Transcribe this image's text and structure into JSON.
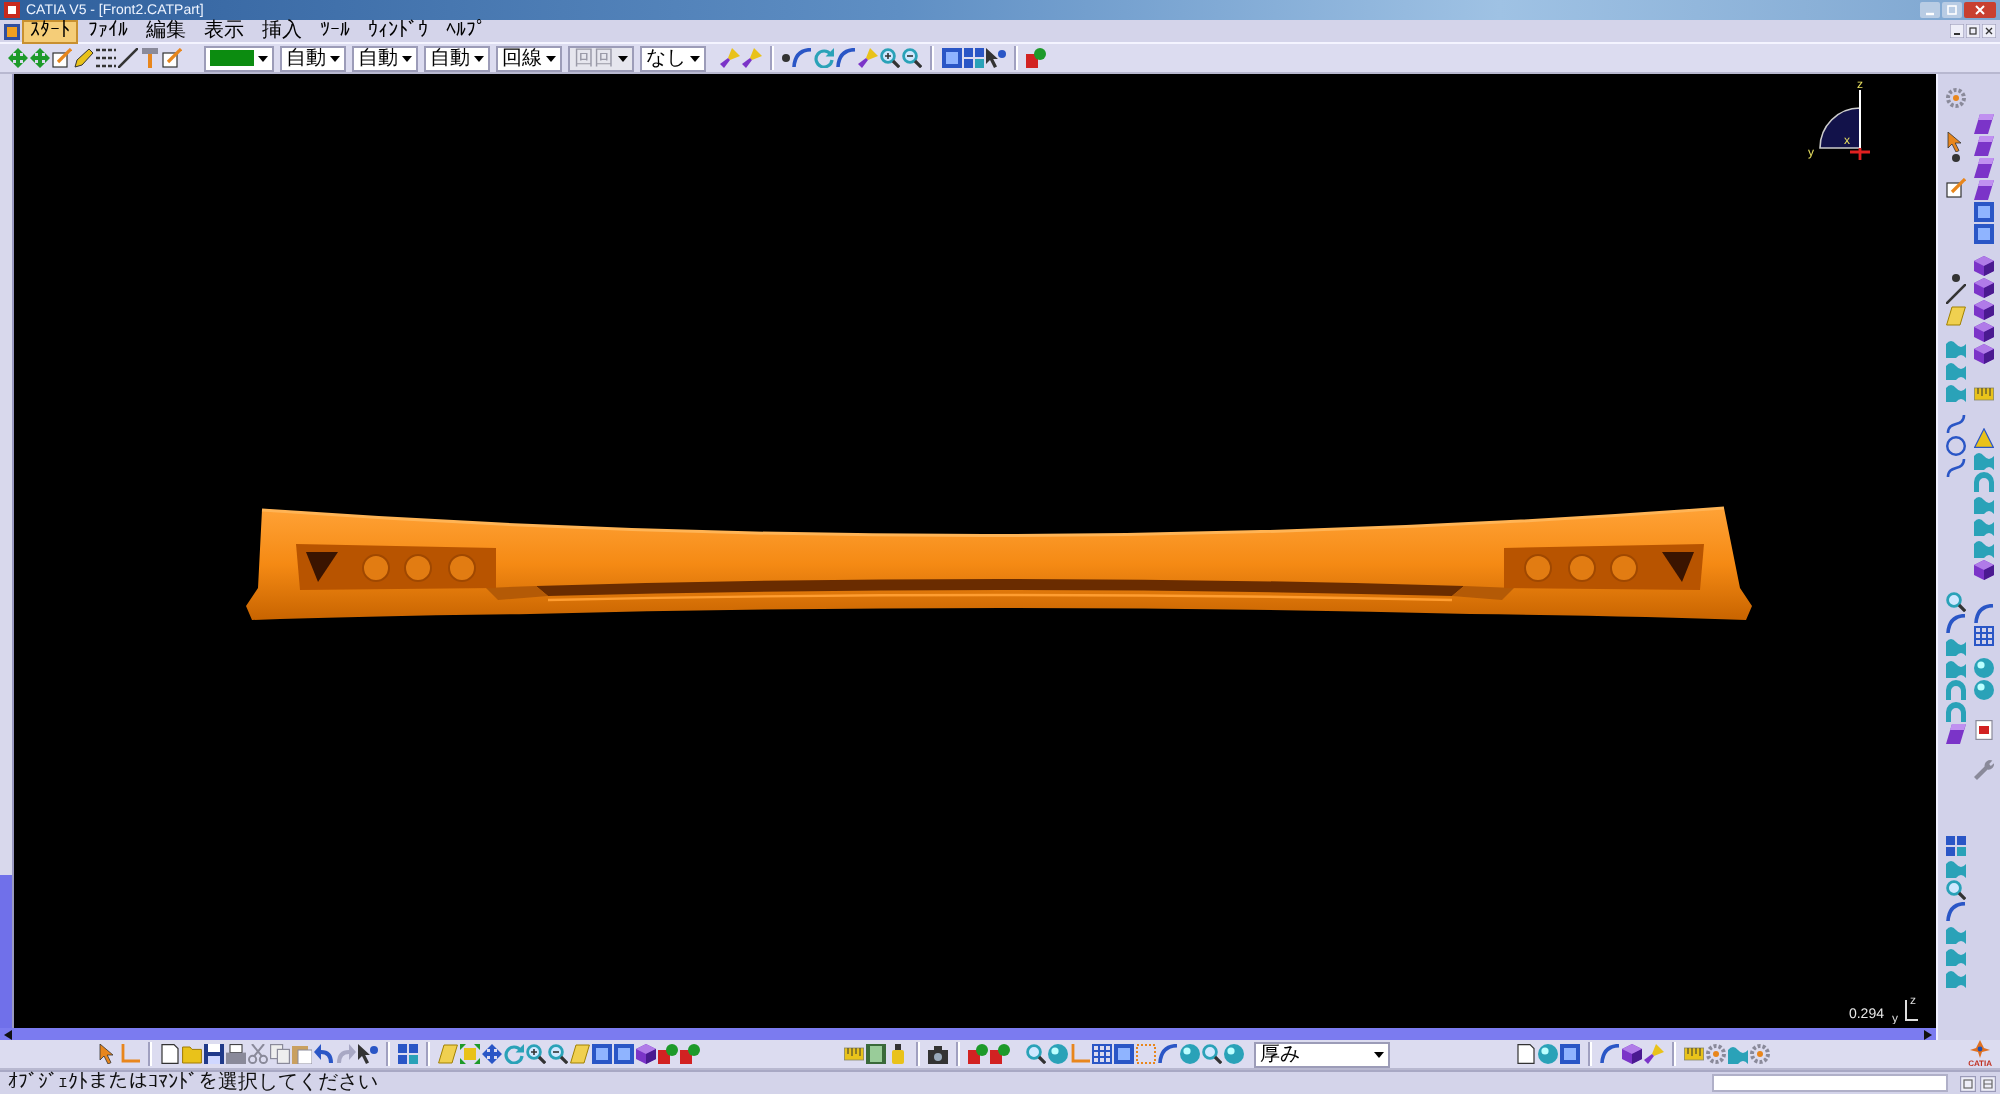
{
  "window": {
    "title": "CATIA V5 - [Front2.CATPart]"
  },
  "menu_bar": {
    "items": [
      {
        "label": "ｽﾀｰﾄ",
        "selected": true
      },
      {
        "label": "ﾌｧｲﾙ",
        "selected": false
      },
      {
        "label": "編集",
        "selected": false
      },
      {
        "label": "表示",
        "selected": false
      },
      {
        "label": "挿入",
        "selected": false
      },
      {
        "label": "ﾂｰﾙ",
        "selected": false
      },
      {
        "label": "ｳｨﾝﾄﾞｳ",
        "selected": false
      },
      {
        "label": "ﾍﾙﾌﾟ",
        "selected": false
      }
    ]
  },
  "graphic_properties": [
    {
      "kind": "color",
      "color": "#0c8c10"
    },
    {
      "kind": "text",
      "value": "自動",
      "disabled": false
    },
    {
      "kind": "text",
      "value": "自動",
      "disabled": false
    },
    {
      "kind": "text",
      "value": "自動",
      "disabled": false
    },
    {
      "kind": "text",
      "value": "回線",
      "disabled": false
    },
    {
      "kind": "text",
      "value": "回回",
      "disabled": true
    },
    {
      "kind": "text",
      "value": "なし",
      "disabled": false
    }
  ],
  "viewport": {
    "compass_labels": [
      "z",
      "y",
      "x"
    ],
    "scale": "0.294",
    "triad_labels": [
      "y",
      "z"
    ]
  },
  "bottom_toolbar": {
    "dropdown_value": "厚み",
    "logo_text": "CATIA"
  },
  "status_bar": {
    "message": "ｵﾌﾞｼﾞｪｸﾄまたはｺﾏﾝﾄﾞを選択してください"
  }
}
